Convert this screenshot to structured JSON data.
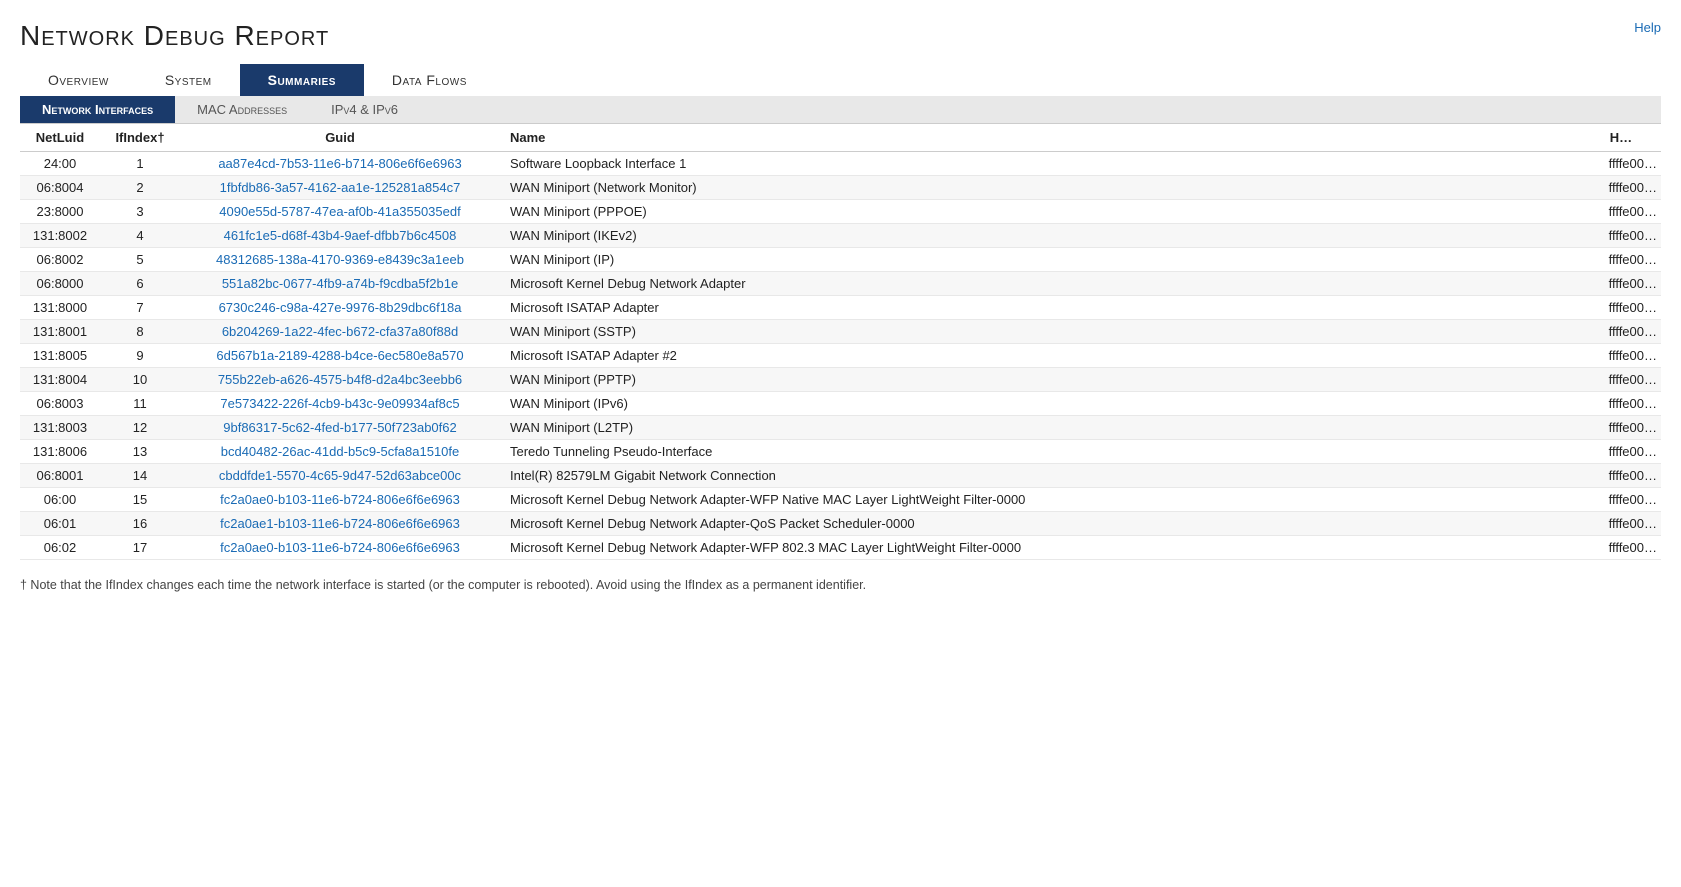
{
  "page": {
    "title": "Network Debug Report",
    "help_label": "Help"
  },
  "main_tabs": [
    {
      "id": "overview",
      "label": "Overview",
      "active": false
    },
    {
      "id": "system",
      "label": "System",
      "active": false
    },
    {
      "id": "summaries",
      "label": "Summaries",
      "active": true
    },
    {
      "id": "data-flows",
      "label": "Data Flows",
      "active": false
    }
  ],
  "sub_tabs": [
    {
      "id": "network-interfaces",
      "label": "Network Interfaces",
      "active": true
    },
    {
      "id": "mac-addresses",
      "label": "MAC Addresses",
      "active": false
    },
    {
      "id": "ipv4-ipv6",
      "label": "IPv4 & IPv6",
      "active": false
    }
  ],
  "table": {
    "columns": [
      "NetLuid",
      "IfIndex†",
      "Guid",
      "Name",
      "H…"
    ],
    "rows": [
      {
        "netluid": "24:00",
        "ifindex": "1",
        "guid": "aa87e4cd-7b53-11e6-b714-806e6f6e6963",
        "name": "Software Loopback Interface 1",
        "hx": "ffffe00…"
      },
      {
        "netluid": "06:8004",
        "ifindex": "2",
        "guid": "1fbfdb86-3a57-4162-aa1e-125281a854c7",
        "name": "WAN Miniport (Network Monitor)",
        "hx": "ffffe00…"
      },
      {
        "netluid": "23:8000",
        "ifindex": "3",
        "guid": "4090e55d-5787-47ea-af0b-41a355035edf",
        "name": "WAN Miniport (PPPOE)",
        "hx": "ffffe00…"
      },
      {
        "netluid": "131:8002",
        "ifindex": "4",
        "guid": "461fc1e5-d68f-43b4-9aef-dfbb7b6c4508",
        "name": "WAN Miniport (IKEv2)",
        "hx": "ffffe00…"
      },
      {
        "netluid": "06:8002",
        "ifindex": "5",
        "guid": "48312685-138a-4170-9369-e8439c3a1eeb",
        "name": "WAN Miniport (IP)",
        "hx": "ffffe00…"
      },
      {
        "netluid": "06:8000",
        "ifindex": "6",
        "guid": "551a82bc-0677-4fb9-a74b-f9cdba5f2b1e",
        "name": "Microsoft Kernel Debug Network Adapter",
        "hx": "ffffe00…"
      },
      {
        "netluid": "131:8000",
        "ifindex": "7",
        "guid": "6730c246-c98a-427e-9976-8b29dbc6f18a",
        "name": "Microsoft ISATAP Adapter",
        "hx": "ffffe00…"
      },
      {
        "netluid": "131:8001",
        "ifindex": "8",
        "guid": "6b204269-1a22-4fec-b672-cfa37a80f88d",
        "name": "WAN Miniport (SSTP)",
        "hx": "ffffe00…"
      },
      {
        "netluid": "131:8005",
        "ifindex": "9",
        "guid": "6d567b1a-2189-4288-b4ce-6ec580e8a570",
        "name": "Microsoft ISATAP Adapter #2",
        "hx": "ffffe00…"
      },
      {
        "netluid": "131:8004",
        "ifindex": "10",
        "guid": "755b22eb-a626-4575-b4f8-d2a4bc3eebb6",
        "name": "WAN Miniport (PPTP)",
        "hx": "ffffe00…"
      },
      {
        "netluid": "06:8003",
        "ifindex": "11",
        "guid": "7e573422-226f-4cb9-b43c-9e09934af8c5",
        "name": "WAN Miniport (IPv6)",
        "hx": "ffffe00…"
      },
      {
        "netluid": "131:8003",
        "ifindex": "12",
        "guid": "9bf86317-5c62-4fed-b177-50f723ab0f62",
        "name": "WAN Miniport (L2TP)",
        "hx": "ffffe00…"
      },
      {
        "netluid": "131:8006",
        "ifindex": "13",
        "guid": "bcd40482-26ac-41dd-b5c9-5cfa8a1510fe",
        "name": "Teredo Tunneling Pseudo-Interface",
        "hx": "ffffe00…"
      },
      {
        "netluid": "06:8001",
        "ifindex": "14",
        "guid": "cbddfde1-5570-4c65-9d47-52d63abce00c",
        "name": "Intel(R) 82579LM Gigabit Network Connection",
        "hx": "ffffe00…"
      },
      {
        "netluid": "06:00",
        "ifindex": "15",
        "guid": "fc2a0ae0-b103-11e6-b724-806e6f6e6963",
        "name": "Microsoft Kernel Debug Network Adapter-WFP Native MAC Layer LightWeight Filter-0000",
        "hx": "ffffe00…"
      },
      {
        "netluid": "06:01",
        "ifindex": "16",
        "guid": "fc2a0ae1-b103-11e6-b724-806e6f6e6963",
        "name": "Microsoft Kernel Debug Network Adapter-QoS Packet Scheduler-0000",
        "hx": "ffffe00…"
      },
      {
        "netluid": "06:02",
        "ifindex": "17",
        "guid": "fc2a0ae0-b103-11e6-b724-806e6f6e6963",
        "name": "Microsoft Kernel Debug Network Adapter-WFP 802.3 MAC Layer LightWeight Filter-0000",
        "hx": "ffffe00…"
      }
    ]
  },
  "footnote": "† Note that the IfIndex changes each time the network interface is started (or the computer is rebooted). Avoid using the IfIndex as a permanent identifier."
}
